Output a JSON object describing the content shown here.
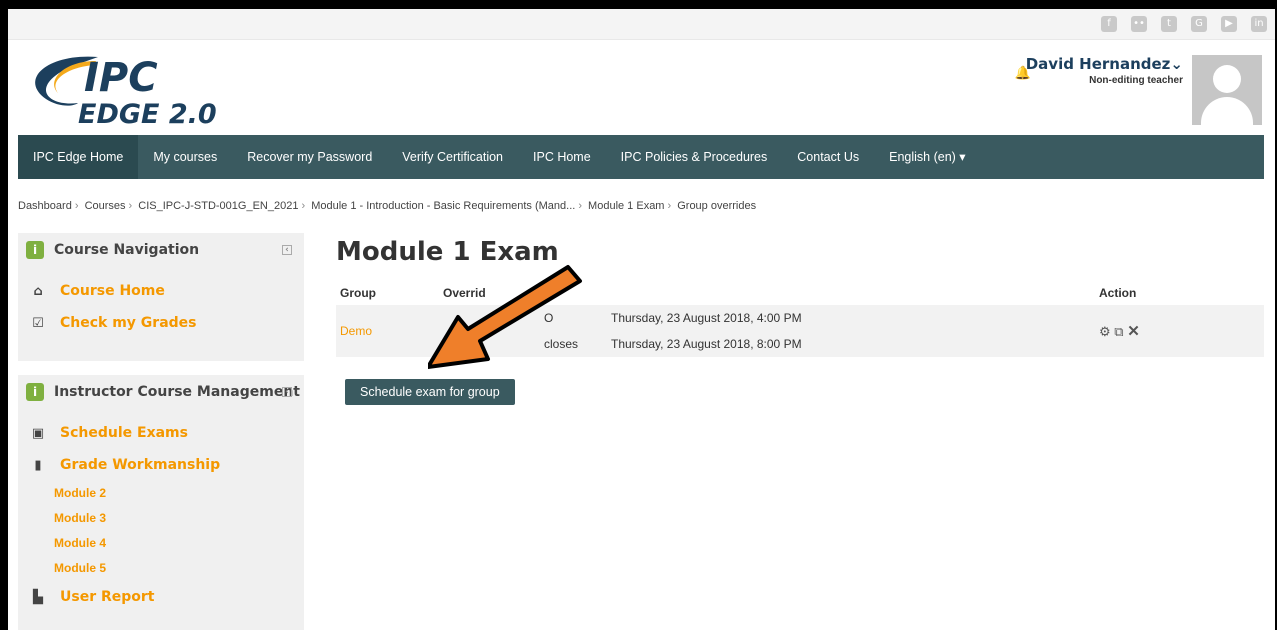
{
  "social": {
    "icons": [
      "facebook-icon",
      "flickr-icon",
      "twitter-icon",
      "google-plus-icon",
      "youtube-icon",
      "linkedin-icon"
    ]
  },
  "brand": {
    "line1": "IPC",
    "line2": "EDGE 2.0"
  },
  "user": {
    "name": "David Hernandez",
    "role": "Non-editing teacher"
  },
  "nav": {
    "items": [
      "IPC Edge Home",
      "My courses",
      "Recover my Password",
      "Verify Certification",
      "IPC Home",
      "IPC Policies & Procedures",
      "Contact Us",
      "English (en) ▾"
    ]
  },
  "breadcrumb": [
    "Dashboard",
    "Courses",
    "CIS_IPC-J-STD-001G_EN_2021",
    "Module 1 - Introduction - Basic Requirements (Mand...",
    "Module 1 Exam",
    "Group overrides"
  ],
  "course_nav": {
    "title": "Course Navigation",
    "links": [
      {
        "label": "Course Home",
        "icon": "home-icon"
      },
      {
        "label": "Check my Grades",
        "icon": "checkbox-icon"
      }
    ]
  },
  "instructor": {
    "title": "Instructor Course Management",
    "links": [
      {
        "label": "Schedule Exams",
        "icon": "calendar-check-icon"
      },
      {
        "label": "Grade Workmanship",
        "icon": "chip-icon"
      }
    ],
    "modules": [
      "Module 2",
      "Module 3",
      "Module 4",
      "Module 5"
    ],
    "report": {
      "label": "User Report",
      "icon": "file-icon"
    }
  },
  "main": {
    "title": "Module 1 Exam",
    "columns": {
      "group": "Group",
      "overrides": "Overrid",
      "action": "Action"
    },
    "rows": [
      {
        "group": "Demo",
        "opens_label": "O",
        "opens": "Thursday, 23 August 2018, 4:00 PM",
        "closes_label": "closes",
        "closes": "Thursday, 23 August 2018, 8:00 PM"
      }
    ],
    "button": "Schedule exam for group"
  },
  "colors": {
    "nav": "#3a5a60",
    "link": "#f49800",
    "arrow": "#ef7f2a"
  }
}
